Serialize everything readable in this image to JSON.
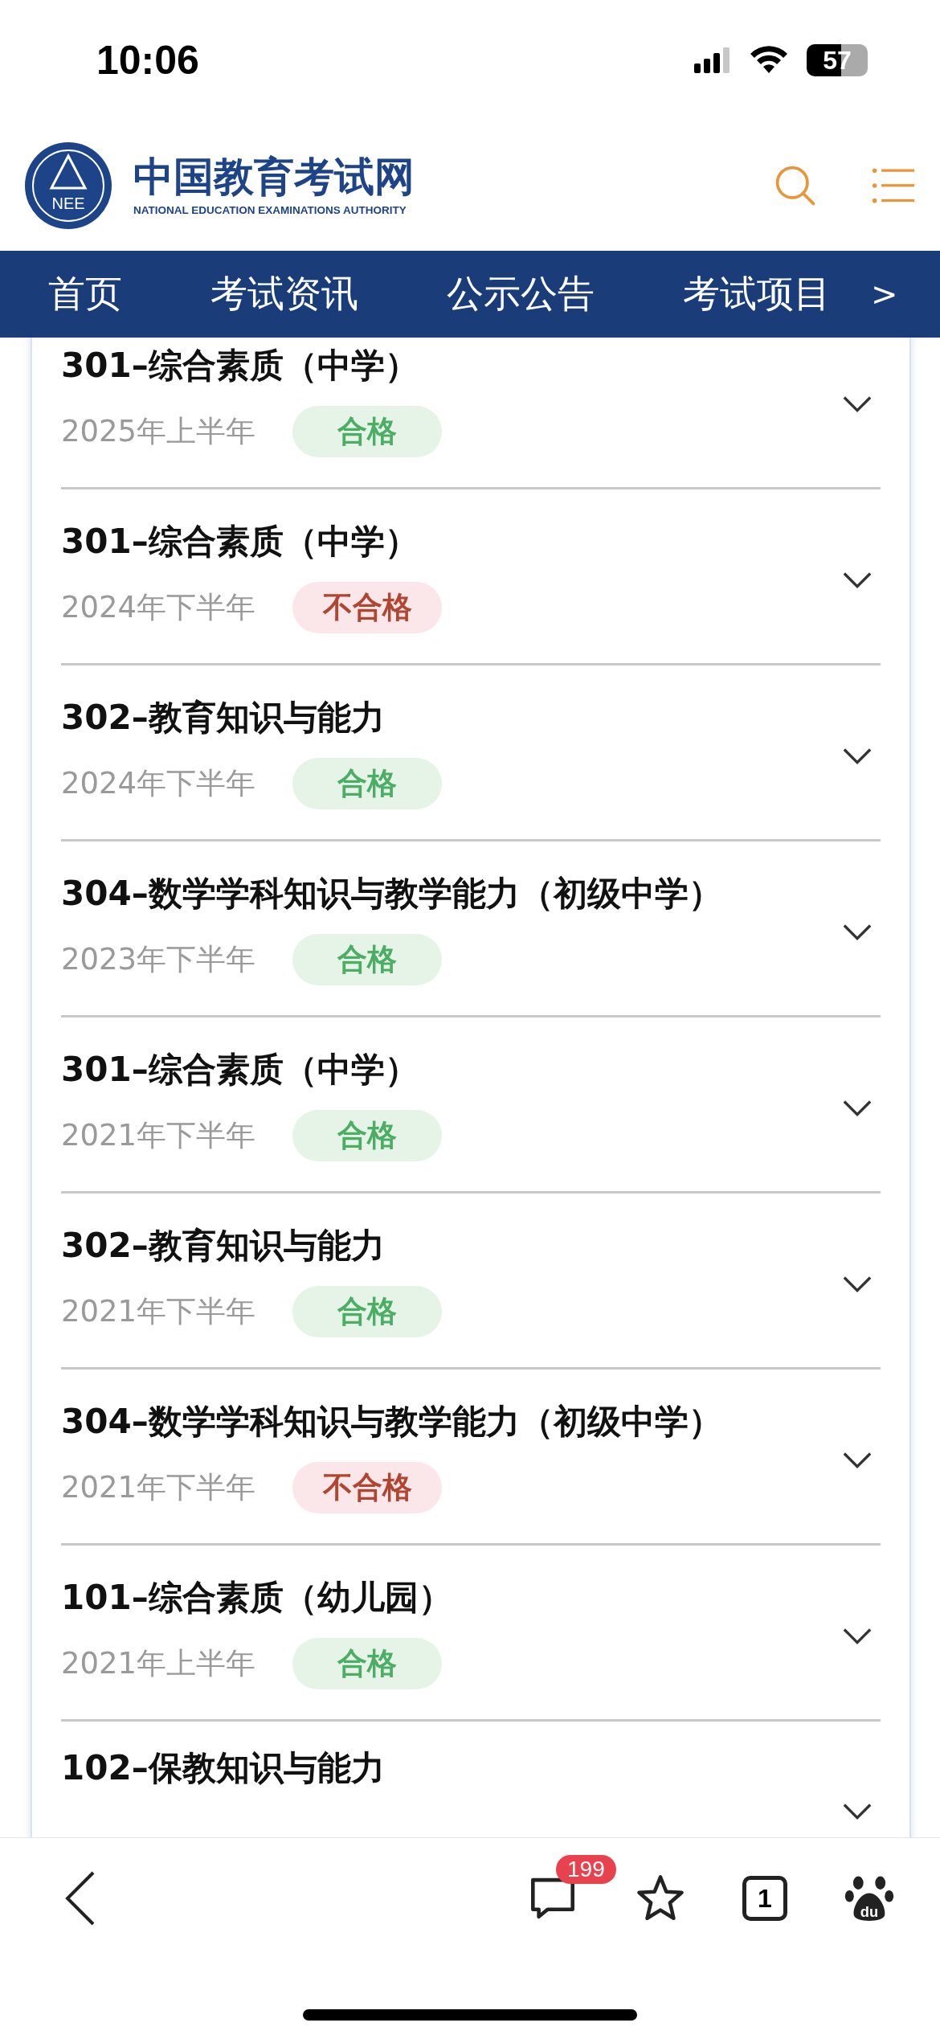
{
  "status_bar": {
    "time": "10:06",
    "battery": "57"
  },
  "header": {
    "logo_mark": "NEE",
    "site_name": "中国教育考试网",
    "site_subtitle": "NATIONAL EDUCATION EXAMINATIONS AUTHORITY"
  },
  "nav": {
    "items": [
      "首页",
      "考试资讯",
      "公示公告",
      "考试项目"
    ],
    "more": ">"
  },
  "results": [
    {
      "subject": "301–综合素质（中学）",
      "term": "2025年上半年",
      "result": "合格",
      "kind": "pass"
    },
    {
      "subject": "301–综合素质（中学）",
      "term": "2024年下半年",
      "result": "不合格",
      "kind": "fail"
    },
    {
      "subject": "302–教育知识与能力",
      "term": "2024年下半年",
      "result": "合格",
      "kind": "pass"
    },
    {
      "subject": "304–数学学科知识与教学能力（初级中学）",
      "term": "2023年下半年",
      "result": "合格",
      "kind": "pass"
    },
    {
      "subject": "301–综合素质（中学）",
      "term": "2021年下半年",
      "result": "合格",
      "kind": "pass"
    },
    {
      "subject": "302–教育知识与能力",
      "term": "2021年下半年",
      "result": "合格",
      "kind": "pass"
    },
    {
      "subject": "304–数学学科知识与教学能力（初级中学）",
      "term": "2021年下半年",
      "result": "不合格",
      "kind": "fail"
    },
    {
      "subject": "101–综合素质（幼儿园）",
      "term": "2021年上半年",
      "result": "合格",
      "kind": "pass"
    },
    {
      "subject": "102–保教知识与能力"
    }
  ],
  "toolbar": {
    "comments_badge": "199",
    "tab_count": "1",
    "app_mark": "du"
  }
}
